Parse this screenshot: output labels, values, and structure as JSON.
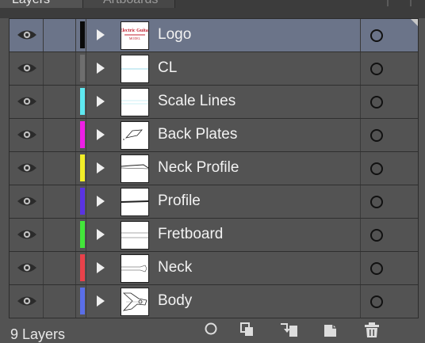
{
  "tabs": [
    {
      "label": "Layers",
      "active": true
    },
    {
      "label": "Artboards",
      "active": false
    }
  ],
  "layers": [
    {
      "name": "Logo",
      "color": "#0a0a0a",
      "selected": true,
      "thumb": "logo"
    },
    {
      "name": "CL",
      "color": "#6e6e6e",
      "selected": false,
      "thumb": "cl"
    },
    {
      "name": "Scale Lines",
      "color": "#5ee8f0",
      "selected": false,
      "thumb": "scale"
    },
    {
      "name": "Back Plates",
      "color": "#ee1ee6",
      "selected": false,
      "thumb": "backplates"
    },
    {
      "name": "Neck Profile",
      "color": "#f2ee28",
      "selected": false,
      "thumb": "neckprofile"
    },
    {
      "name": "Profile",
      "color": "#5a33e2",
      "selected": false,
      "thumb": "profile"
    },
    {
      "name": "Fretboard",
      "color": "#42e63a",
      "selected": false,
      "thumb": "fretboard"
    },
    {
      "name": "Neck",
      "color": "#e8414a",
      "selected": false,
      "thumb": "neck"
    },
    {
      "name": "Body",
      "color": "#5a6ee8",
      "selected": false,
      "thumb": "body"
    }
  ],
  "footer": {
    "layer_count": "9 Layers",
    "icons": [
      "make-clip-mask-icon",
      "create-sublayer-icon",
      "move-to-layer-icon",
      "new-layer-icon",
      "delete-icon"
    ]
  }
}
